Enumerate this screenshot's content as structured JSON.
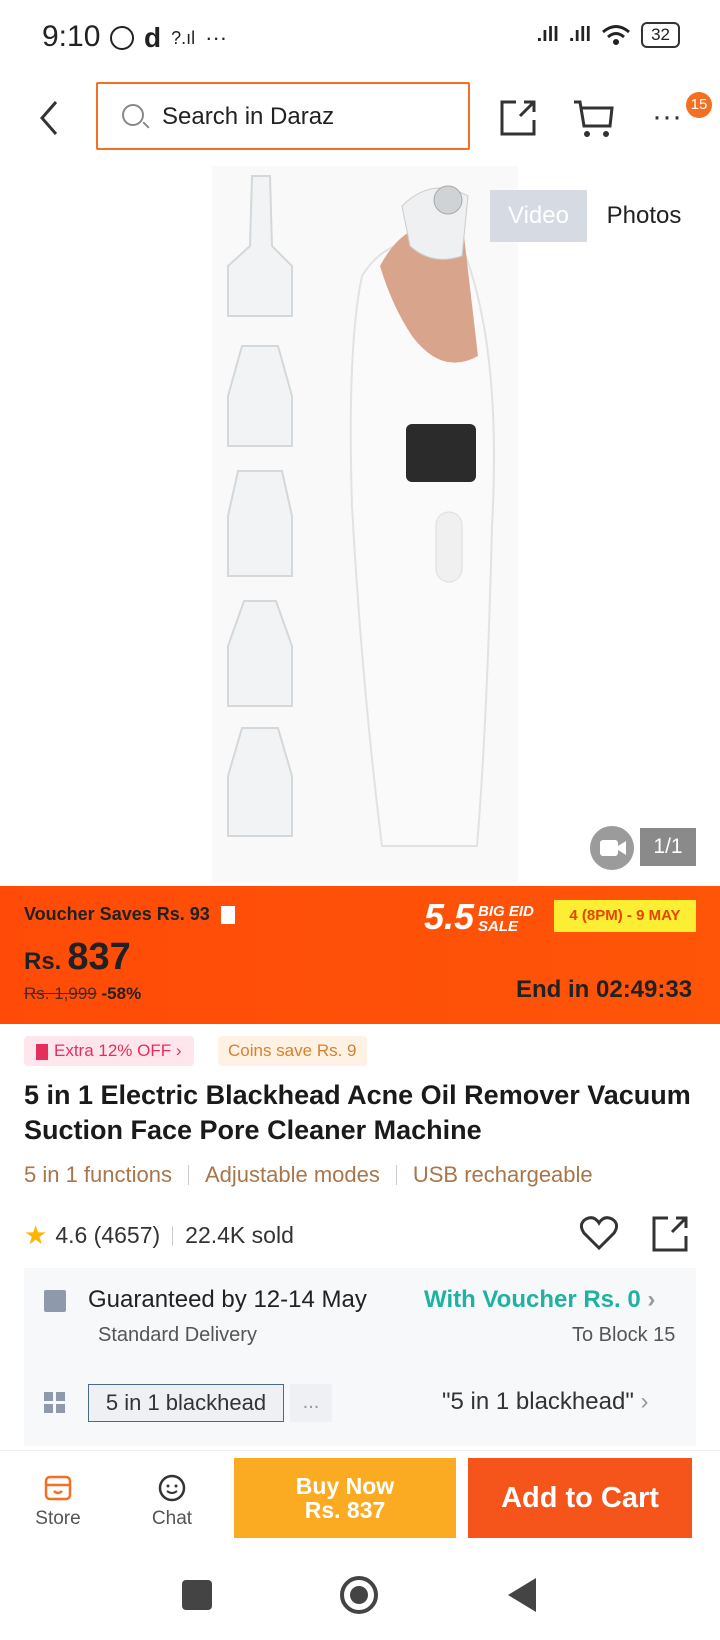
{
  "status_bar": {
    "time": "9:10",
    "battery": "32"
  },
  "search": {
    "placeholder": "Search in Daraz"
  },
  "header": {
    "badge_count": "15"
  },
  "gallery": {
    "video_tab": "Video",
    "photos_tab": "Photos",
    "counter": "1/1"
  },
  "price_banner": {
    "voucher_text": "Voucher Saves Rs. 93",
    "currency": "Rs.",
    "price": "837",
    "original_price": "Rs. 1,999",
    "discount": "-58%",
    "sale_logo": "5.5",
    "sale_logo_small": "BIG EID SALE",
    "sale_dates": "4 (8PM) - 9 MAY",
    "end_in": "End in 02:49:33"
  },
  "promos": {
    "extra_off": "Extra 12% OFF",
    "coins": "Coins save Rs. 9"
  },
  "product": {
    "title": "5 in 1 Electric Blackhead Acne Oil Remover Vacuum Suction Face Pore Cleaner Machine",
    "features": [
      "5 in 1 functions",
      "Adjustable modes",
      "USB rechargeable"
    ],
    "rating": "4.6 (4657)",
    "sold": "22.4K sold"
  },
  "delivery": {
    "guarantee": "Guaranteed by 12-14 May",
    "voucher": "With Voucher Rs. 0",
    "type": "Standard Delivery",
    "location": "To Block 15"
  },
  "variant": {
    "chip": "5 in 1 blackhead",
    "more": "...",
    "selected": "\"5 in 1 blackhead\""
  },
  "bottom_bar": {
    "store": "Store",
    "chat": "Chat",
    "buy_now_line1": "Buy Now",
    "buy_now_line2": "Rs. 837",
    "add_to_cart": "Add to Cart"
  },
  "colors": {
    "accent": "#f36f21",
    "banner": "#fe5508",
    "buy": "#fbab21",
    "cart": "#f5541a",
    "teal": "#1fb2a2"
  }
}
